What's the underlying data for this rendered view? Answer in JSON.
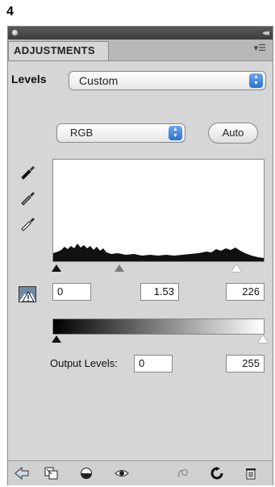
{
  "figure_number": "4",
  "panel": {
    "tab_label": "ADJUSTMENTS",
    "levels_label": "Levels",
    "preset_value": "Custom",
    "channel_value": "RGB",
    "auto_label": "Auto",
    "input_levels": {
      "black": "0",
      "gamma": "1.53",
      "white": "226"
    },
    "output_label": "Output Levels:",
    "output_levels": {
      "black": "0",
      "white": "255"
    }
  },
  "icons": {
    "eyedroppers": [
      "black-point-eyedropper-icon",
      "gray-point-eyedropper-icon",
      "white-point-eyedropper-icon"
    ],
    "bottom_tools": [
      "back-arrow-icon",
      "clip-to-layer-icon",
      "visibility-toggle-icon",
      "eye-icon",
      "previous-state-icon",
      "reset-icon",
      "trash-icon"
    ]
  }
}
